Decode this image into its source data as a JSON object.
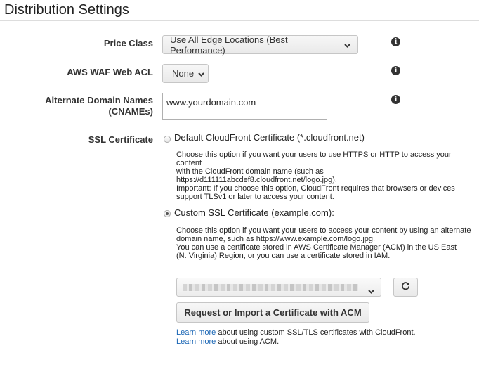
{
  "page_title": "Distribution Settings",
  "price_class": {
    "label": "Price Class",
    "value": "Use All Edge Locations (Best Performance)"
  },
  "waf": {
    "label": "AWS WAF Web ACL",
    "value": "None"
  },
  "cnames": {
    "label_line1": "Alternate Domain Names",
    "label_line2": "(CNAMEs)",
    "value": "www.yourdomain.com"
  },
  "ssl": {
    "label": "SSL Certificate",
    "default_option": {
      "label": "Default CloudFront Certificate (*.cloudfront.net)",
      "selected": false,
      "desc_lines": [
        "Choose this option if you want your users to use HTTPS or HTTP to access your content",
        "with the CloudFront domain name (such as",
        "https://d111111abcdef8.cloudfront.net/logo.jpg).",
        "Important: If you choose this option, CloudFront requires that browsers or devices",
        "support TLSv1 or later to access your content."
      ]
    },
    "custom_option": {
      "label": "Custom SSL Certificate (example.com):",
      "selected": true,
      "desc_lines": [
        "Choose this option if you want your users to access your content by using an alternate",
        "domain name, such as https://www.example.com/logo.jpg.",
        "You can use a certificate stored in AWS Certificate Manager (ACM) in the US East",
        "(N. Virginia) Region, or you can use a certificate stored in IAM."
      ]
    },
    "request_button": "Request or Import a Certificate with ACM",
    "help1": {
      "link": "Learn more",
      "text": " about using custom SSL/TLS certificates with CloudFront."
    },
    "help2": {
      "link": "Learn more",
      "text": " about using ACM."
    }
  },
  "icons": {
    "info": "info-icon",
    "chevron": "chevron-down-icon",
    "refresh": "refresh-icon"
  }
}
